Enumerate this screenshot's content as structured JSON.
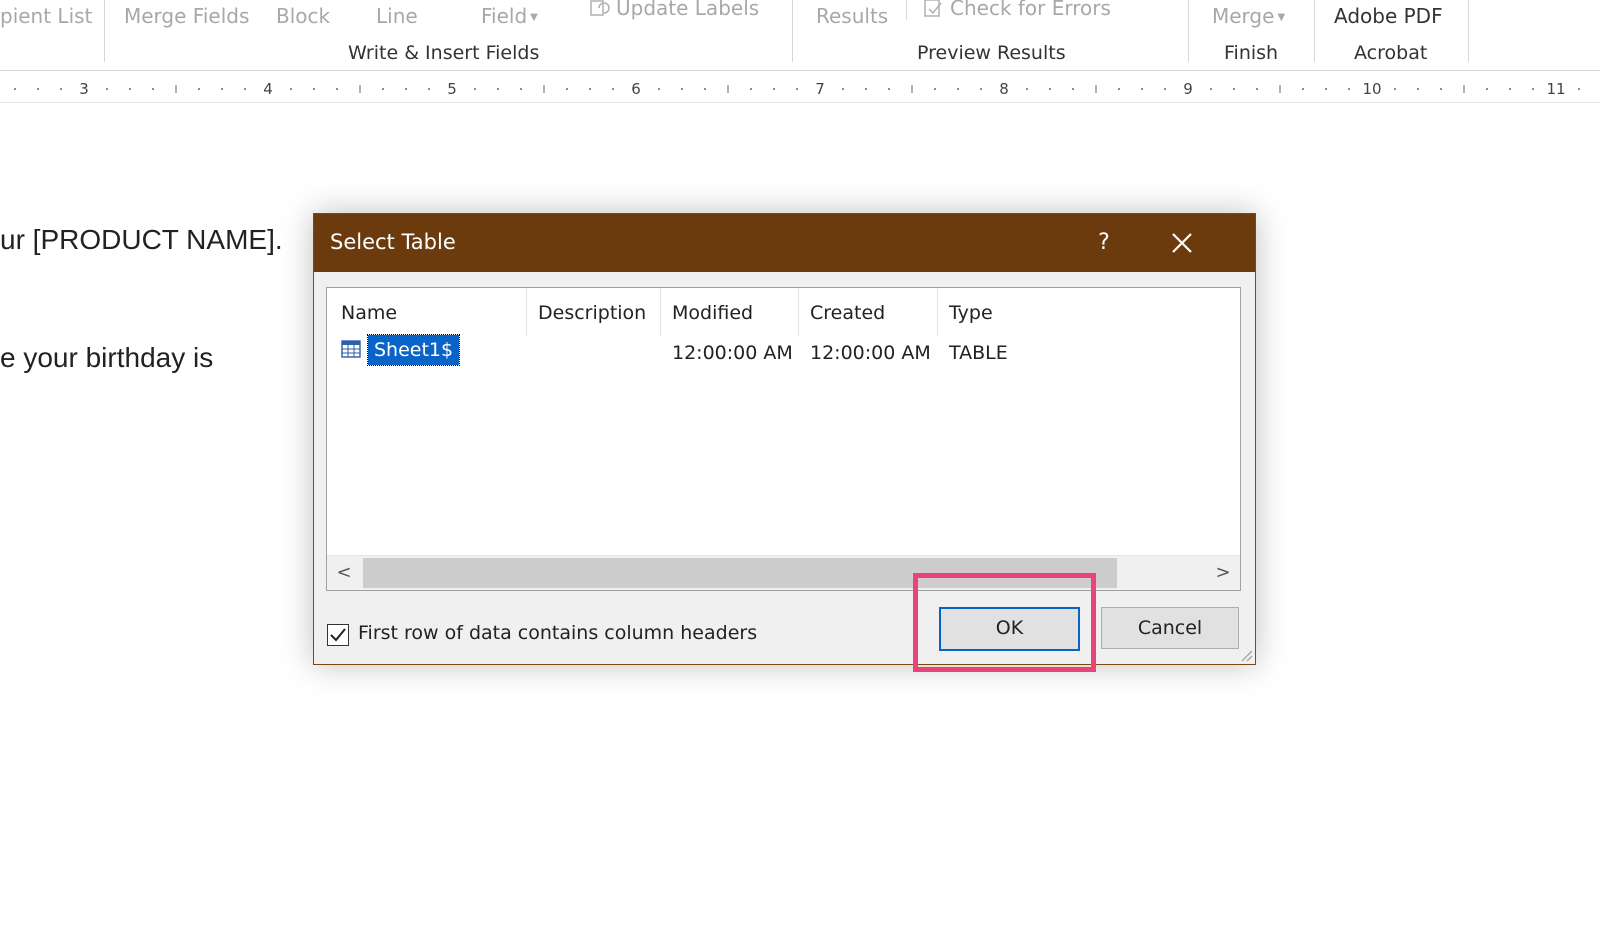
{
  "ribbon": {
    "items": {
      "recipient_list": "pient List",
      "merge_fields": "Merge Fields",
      "block": "Block",
      "line": "Line",
      "field": "Field",
      "update_labels": "Update Labels",
      "results": "Results",
      "check_for_errors": "Check for Errors",
      "merge": "Merge",
      "adobe_pdf": "Adobe PDF"
    },
    "groups": {
      "write_insert": "Write & Insert Fields",
      "preview_results": "Preview Results",
      "finish": "Finish",
      "acrobat": "Acrobat"
    }
  },
  "ruler": {
    "numbers": [
      "3",
      "4",
      "5",
      "6",
      "7",
      "8",
      "9",
      "10",
      "11"
    ]
  },
  "document": {
    "line1": "ur [PRODUCT NAME].",
    "line2": "e your birthday is"
  },
  "dialog": {
    "title": "Select Table",
    "help": "?",
    "columns": [
      "Name",
      "Description",
      "Modified",
      "Created",
      "Type"
    ],
    "rows": [
      {
        "name": "Sheet1$",
        "description": "",
        "modified": "12:00:00 AM",
        "created": "12:00:00 AM",
        "type": "TABLE",
        "selected": true
      }
    ],
    "checkbox_label": "First row of data contains column headers",
    "checkbox_checked": true,
    "ok_label": "OK",
    "cancel_label": "Cancel",
    "scroll_left": "<",
    "scroll_right": ">"
  },
  "colors": {
    "titlebar": "#6b3b0e",
    "selection": "#0a64c8",
    "highlight": "#e8437a"
  }
}
